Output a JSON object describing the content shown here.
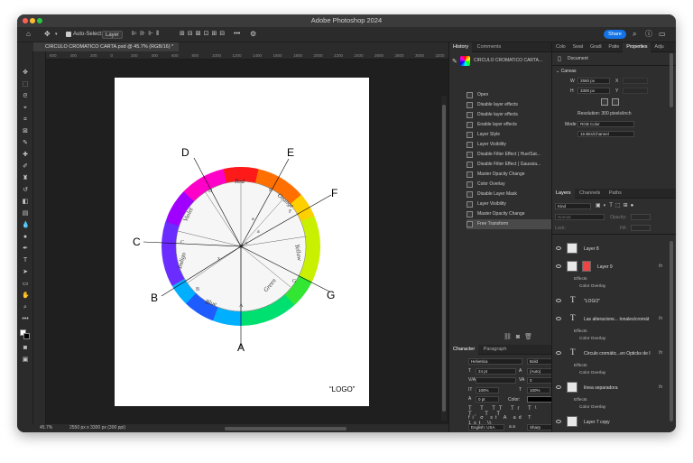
{
  "app": {
    "title": "Adobe Photoshop 2024"
  },
  "options_bar": {
    "auto_select_label": "Auto-Select:",
    "auto_select_value": "Layer",
    "share_label": "Share"
  },
  "document": {
    "tab_title": "CIRCULO CROMATICO CARTA.psd @ 45.7% (RGB/16) *",
    "zoom": "45.7%",
    "status_info": "2550 px x 3300 px (300 ppi)",
    "logo_text": "“LOGO”",
    "ruler_ticks": [
      "600",
      "400",
      "200",
      "0",
      "200",
      "400",
      "600",
      "800",
      "1000",
      "1200",
      "1400",
      "1600",
      "1800",
      "2000",
      "2200",
      "2400",
      "2600",
      "2800",
      "3000",
      "3200"
    ],
    "wheel": {
      "outer_letters": [
        "D",
        "E",
        "F",
        "C",
        "G",
        "B",
        "A"
      ],
      "inner_labels": [
        "Red",
        "Orange",
        "Yellow",
        "Green",
        "Blue",
        "Indigo",
        "Violet"
      ]
    }
  },
  "history_panel": {
    "tabs": [
      "History",
      "Comments"
    ],
    "snapshot": "CIRCULO CROMATICO CARTA...",
    "items": [
      "Open",
      "Disable layer effects",
      "Disable layer effects",
      "Enable layer effects",
      "Layer Style",
      "Layer Visibility",
      "Disable Filter Effect ( Hue/Sat...",
      "Disable Filter Effect ( Gaussia...",
      "Master Opacity Change",
      "Color Overlay",
      "Disable Layer Mask",
      "Layer Visibility",
      "Master Opacity Change",
      "Free Transform"
    ],
    "selected_index": 13
  },
  "character_panel": {
    "tabs": [
      "Character",
      "Paragraph"
    ],
    "font_family": "Helvetica",
    "font_style": "Bold",
    "size": "24 pt",
    "leading": "(Auto)",
    "kerning": "",
    "tracking": "0",
    "vscale": "100%",
    "hscale": "100%",
    "baseline": "0 pt",
    "color_label": "Color:",
    "language": "English: USA",
    "aa_label": "a a",
    "antialias": "Sharp",
    "glyphs": [
      "T",
      "T",
      "TT",
      "Tr",
      "T¹",
      "T,",
      "T",
      "T"
    ],
    "glyphs2": [
      "fi",
      "σ",
      "st",
      "A",
      "ad",
      "T",
      "1st",
      "½"
    ]
  },
  "properties_panel": {
    "tabs": [
      "Colo",
      "Swat",
      "Gradi",
      "Patte",
      "Properties",
      "Adju"
    ],
    "type": "Document",
    "section": "Canvas",
    "w_label": "W",
    "w": "2550 px",
    "h_label": "H",
    "h": "3300 px",
    "x_label": "X",
    "y_label": "Y",
    "resolution": "Resolution: 300 pixels/inch",
    "mode_label": "Mode",
    "mode": "RGB Color",
    "bit_depth": "16 Bits/Channel"
  },
  "layers_panel": {
    "tabs": [
      "Layers",
      "Channels",
      "Paths"
    ],
    "kind": "Kind",
    "blend": "Normal",
    "opacity_label": "Opacity:",
    "lock_label": "Lock:",
    "fill_label": "Fill:",
    "layers": [
      {
        "name": "Layer 8",
        "type": "pixel"
      },
      {
        "name": "Layer 9",
        "type": "pixel",
        "effects": [
          "Effects",
          "Color Overlay"
        ]
      },
      {
        "name": "\"LOGO\"",
        "type": "text"
      },
      {
        "name": "Las alteracione... tonales/cromát",
        "type": "text",
        "effects": [
          "Effects",
          "Color Overlay"
        ]
      },
      {
        "name": "Círculo cromátic...en Opticks de I",
        "type": "text",
        "effects": [
          "Effects",
          "Color Overlay"
        ]
      },
      {
        "name": "línea separadora",
        "type": "pixel",
        "effects": [
          "Effects",
          "Color Overlay"
        ]
      },
      {
        "name": "Layer 7 copy",
        "type": "pixel"
      }
    ]
  }
}
